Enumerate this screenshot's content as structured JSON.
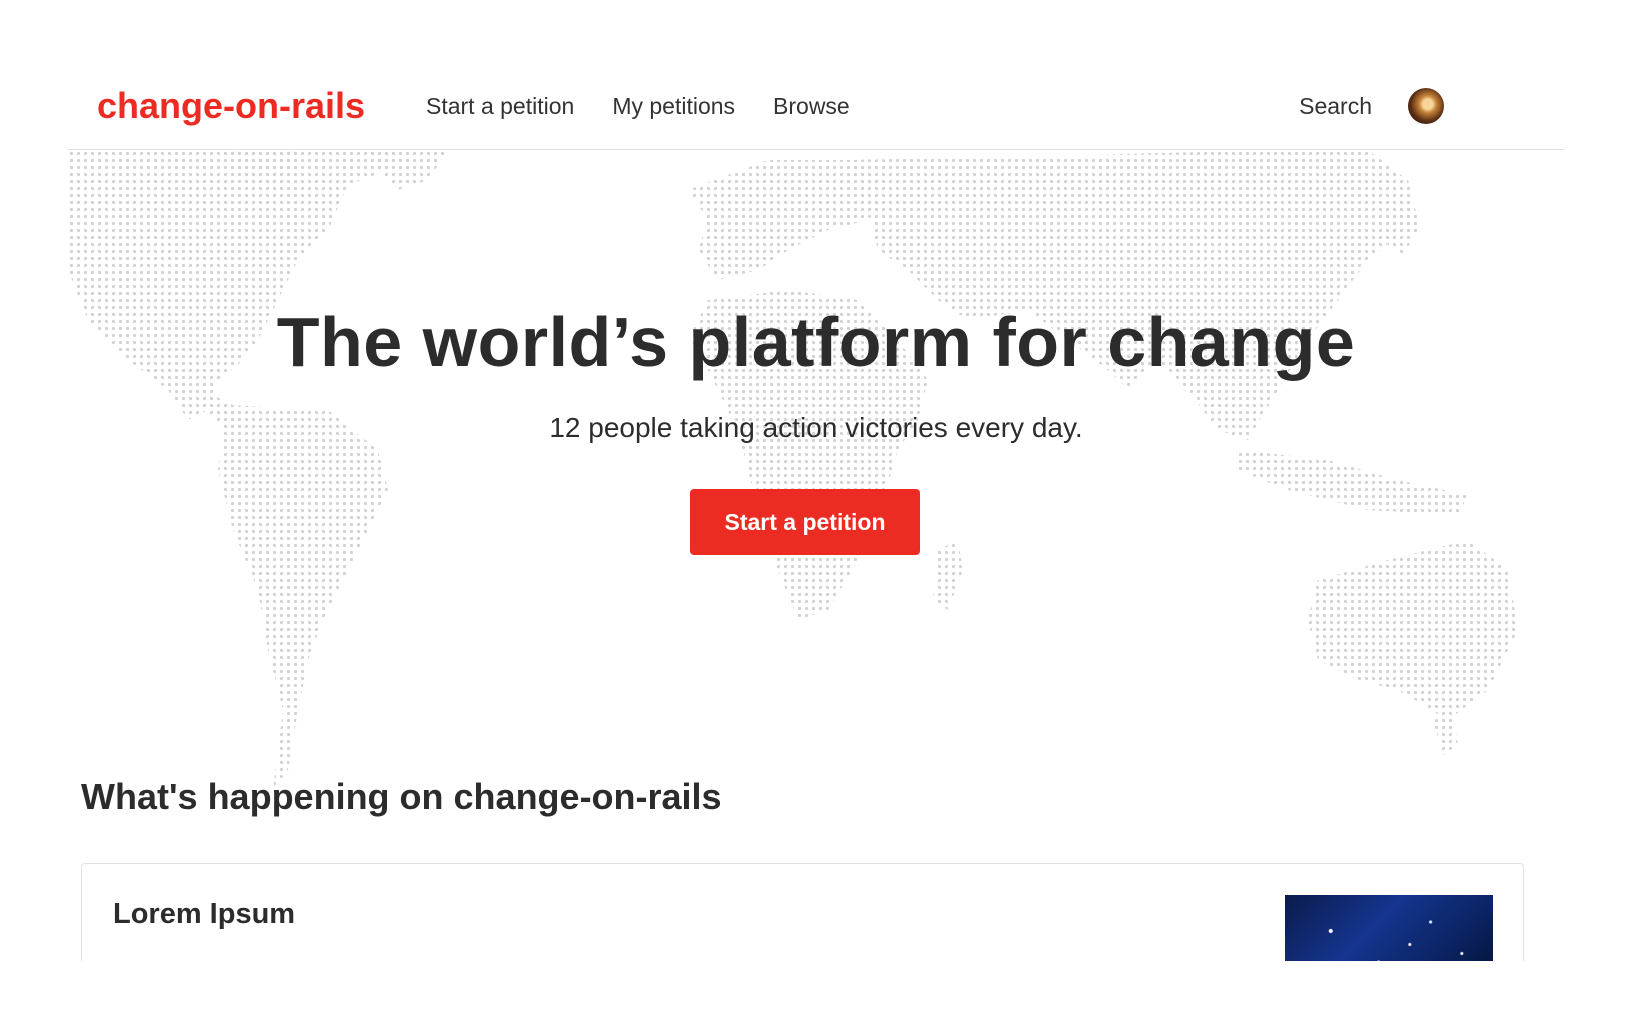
{
  "header": {
    "logo": "change-on-rails",
    "nav": [
      "Start a petition",
      "My petitions",
      "Browse"
    ],
    "search_label": "Search"
  },
  "hero": {
    "title": "The world’s platform for change",
    "subtitle": "12 people taking action victories every day.",
    "cta_label": "Start a petition"
  },
  "feed": {
    "section_title": "What's happening on change-on-rails",
    "cards": [
      {
        "title": "Lorem Ipsum"
      }
    ]
  },
  "colors": {
    "brand": "#ec2c22",
    "text": "#2c2c2c",
    "map_dot": "#d2d2d2"
  }
}
